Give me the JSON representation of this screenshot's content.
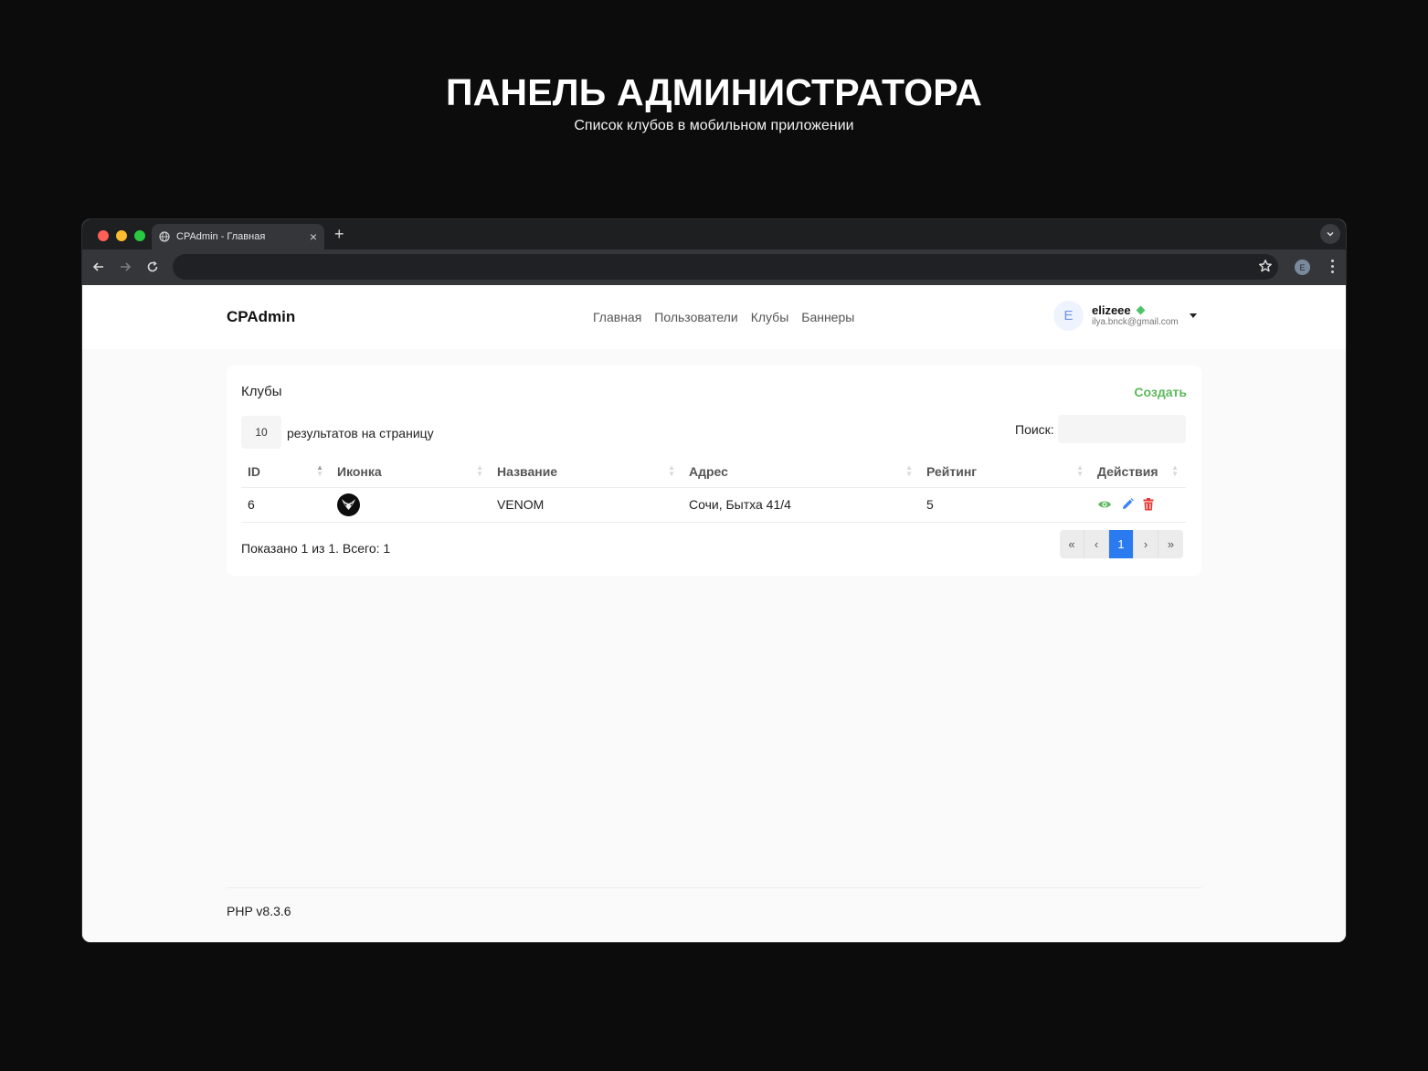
{
  "hero": {
    "title": "ПАНЕЛЬ АДМИНИСТРАТОРА",
    "subtitle": "Список клубов в мобильном приложении"
  },
  "browser": {
    "tab_title": "CPAdmin - Главная",
    "new_tab": "+",
    "close_tab": "×",
    "profile_letter": "E",
    "colors": {
      "light_red": "#fe5f57",
      "light_yellow": "#febc2e",
      "light_green": "#28c840"
    }
  },
  "nav": {
    "brand": "CPAdmin",
    "links": [
      "Главная",
      "Пользователи",
      "Клубы",
      "Баннеры"
    ],
    "user": {
      "avatar_letter": "E",
      "name": "elizeee",
      "email": "ilya.bnck@gmail.com"
    }
  },
  "clubs": {
    "title": "Клубы",
    "create_label": "Создать",
    "per_page_value": "10",
    "per_page_label": "результатов на страницу",
    "search_label": "Поиск:",
    "search_value": "",
    "columns": [
      "ID",
      "Иконка",
      "Название",
      "Адрес",
      "Рейтинг",
      "Действия"
    ],
    "rows": [
      {
        "id": "6",
        "icon": "venom-logo-icon",
        "name": "VENOM",
        "address": "Сочи, Бытха 41/4",
        "rating": "5"
      }
    ],
    "info": "Показано 1 из 1. Всего: 1",
    "pagination": {
      "first": "«",
      "prev": "‹",
      "current": "1",
      "next": "›",
      "last": "»"
    },
    "colors": {
      "create": "#5cb85c",
      "view": "#5cb85c",
      "edit": "#3b82f6",
      "delete": "#e53935",
      "active_page": "#2b7bf0"
    }
  },
  "footer": {
    "text": "PHP v8.3.6"
  }
}
